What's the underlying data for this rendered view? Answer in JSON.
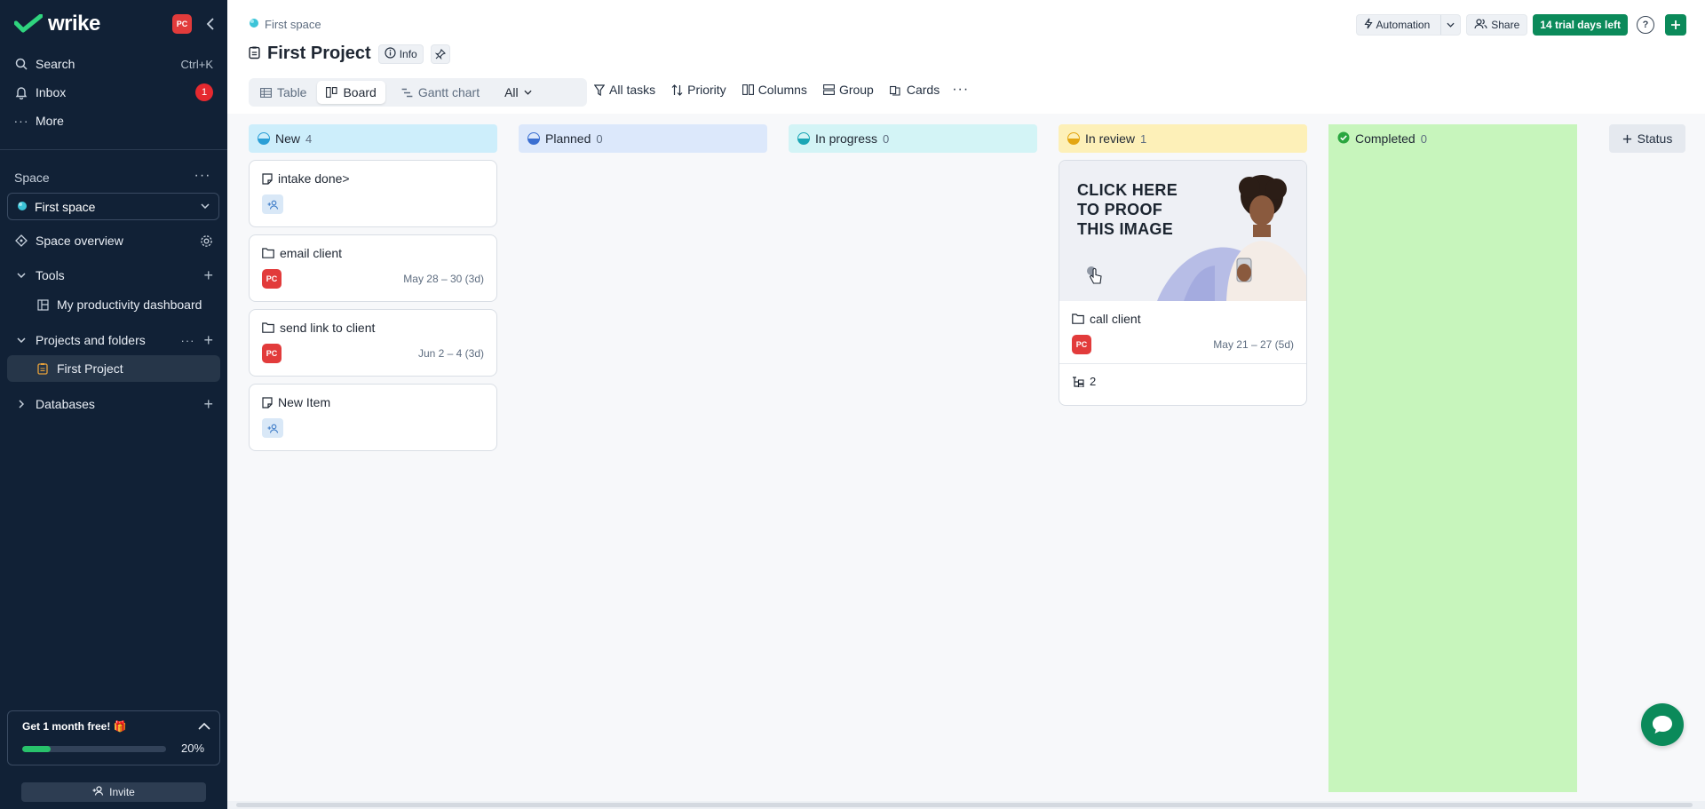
{
  "sidebar": {
    "logo": "wrike",
    "user_initials": "PC",
    "search": {
      "label": "Search",
      "shortcut": "Ctrl+K"
    },
    "inbox": {
      "label": "Inbox",
      "badge": "1"
    },
    "more": {
      "label": "More"
    },
    "space_section": "Space",
    "space_selected": "First space",
    "space_overview": "Space overview",
    "tools": "Tools",
    "productivity": "My productivity dashboard",
    "projects_folders": "Projects and folders",
    "first_project": "First Project",
    "databases": "Databases",
    "promo": {
      "title": "Get 1 month free! 🎁",
      "progress_pct": 20,
      "progress_label": "20%"
    },
    "invite": "Invite"
  },
  "header": {
    "breadcrumb": "First space",
    "title": "First Project",
    "info": "Info",
    "automation": "Automation",
    "share": "Share",
    "trial": "14 trial days left",
    "help": "?"
  },
  "views": {
    "table": "Table",
    "board": "Board",
    "gantt": "Gantt chart",
    "filter": "All"
  },
  "toolbar": {
    "all_tasks": "All tasks",
    "priority": "Priority",
    "columns": "Columns",
    "group": "Group",
    "cards": "Cards"
  },
  "columns": [
    {
      "name": "New",
      "count": "4",
      "bg": "#cdeefb",
      "dot": "#2a9fd6"
    },
    {
      "name": "Planned",
      "count": "0",
      "bg": "#dce8fb",
      "dot": "#3b6fd1"
    },
    {
      "name": "In progress",
      "count": "0",
      "bg": "#d3f4f6",
      "dot": "#1ba6b5"
    },
    {
      "name": "In review",
      "count": "1",
      "bg": "#fdf0b8",
      "dot": "#e3a612"
    },
    {
      "name": "Completed",
      "count": "0",
      "bg": "#c7f5bc",
      "dot": "#2aa63f"
    }
  ],
  "cards": {
    "c1": {
      "title": "intake done>"
    },
    "c2": {
      "title": "email client",
      "assignee": "PC",
      "date": "May 28 – 30 (3d)"
    },
    "c3": {
      "title": "send link to client",
      "assignee": "PC",
      "date": "Jun 2 – 4 (3d)"
    },
    "c4": {
      "title": "New Item"
    },
    "c5": {
      "title": "call client",
      "assignee": "PC",
      "date": "May 21 – 27 (5d)",
      "proof_text": "CLICK HERE TO PROOF THIS IMAGE",
      "subtasks": "2"
    }
  },
  "status_add": "Status"
}
